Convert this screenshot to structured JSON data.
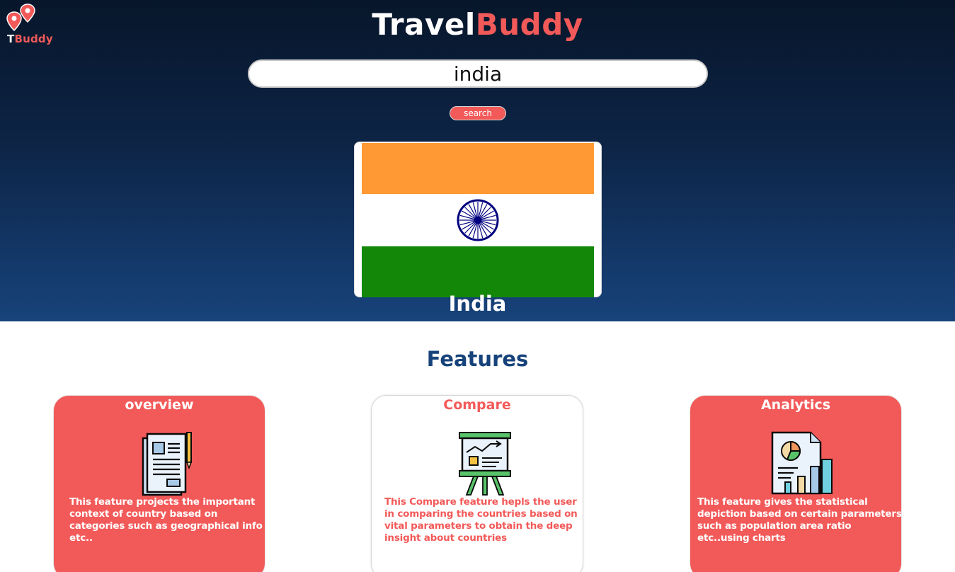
{
  "logo": {
    "text_primary": "T",
    "text_accent": "Buddy",
    "icon": "map-pin-icon"
  },
  "brand": {
    "primary": "Travel",
    "accent": "Buddy"
  },
  "search": {
    "value": "india",
    "button_label": "search"
  },
  "result": {
    "country_name": "India",
    "flag_icon": "india-flag"
  },
  "features": {
    "heading": "Features",
    "cards": [
      {
        "title": "overview",
        "icon": "document-pencil-icon",
        "description": "This feature projects the important context of country based on categories such as geographical info etc.."
      },
      {
        "title": "Compare",
        "icon": "presentation-board-icon",
        "description": "This Compare feature hepls the user in comparing the countries based on vital parameters to obtain the deep insight about countries"
      },
      {
        "title": "Analytics",
        "icon": "analytics-report-icon",
        "description": "This feature gives the statistical depiction based on certain parameters such as population area ratio etc..using charts"
      }
    ]
  },
  "colors": {
    "accent": "#f25a59",
    "navy": "#17437b",
    "hero_top": "#07162a",
    "hero_bottom": "#17437b",
    "flag_saffron": "#ff9933",
    "flag_green": "#138808",
    "flag_chakra": "#000080"
  }
}
